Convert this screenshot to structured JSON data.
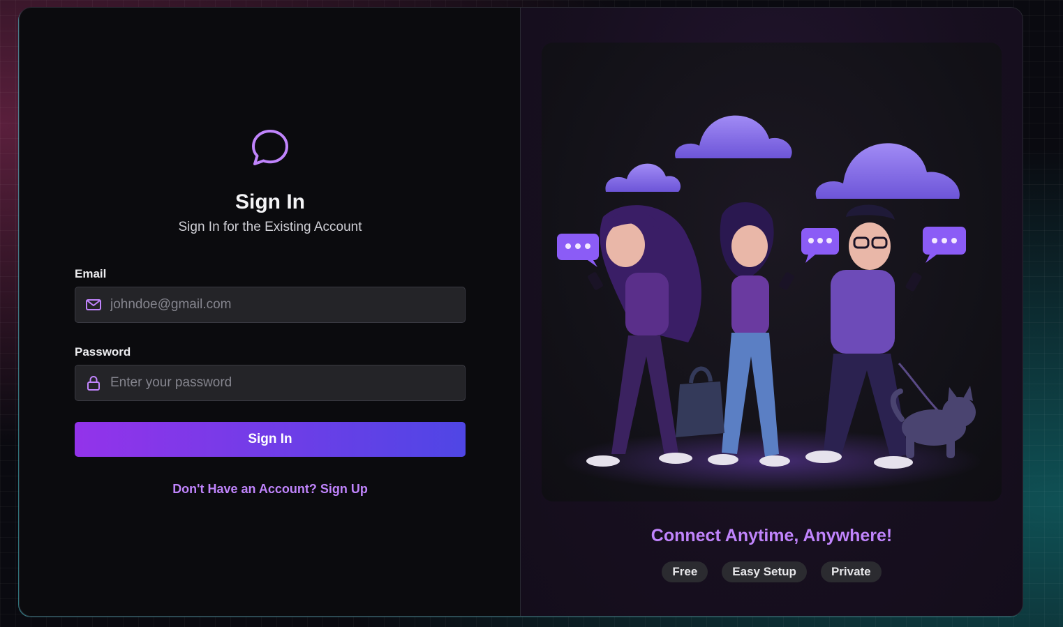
{
  "brand": {
    "logo_icon": "chat-bubble-icon",
    "accent": "#c084fc"
  },
  "form": {
    "title": "Sign In",
    "subtitle": "Sign In for the Existing Account",
    "email_label": "Email",
    "email_placeholder": "johndoe@gmail.com",
    "email_icon": "mail-icon",
    "password_label": "Password",
    "password_placeholder": "Enter your password",
    "password_icon": "lock-icon",
    "submit_label": "Sign In",
    "signup_link": "Don't Have an Account? Sign Up"
  },
  "showcase": {
    "image_alt": "people-chatting-illustration",
    "tagline": "Connect Anytime, Anywhere!",
    "chips": [
      "Free",
      "Easy Setup",
      "Private"
    ]
  },
  "colors": {
    "button_gradient_start": "#9333ea",
    "button_gradient_end": "#4f46e5",
    "panel_left": "#0b0b0e",
    "panel_right": "#170f1f"
  }
}
